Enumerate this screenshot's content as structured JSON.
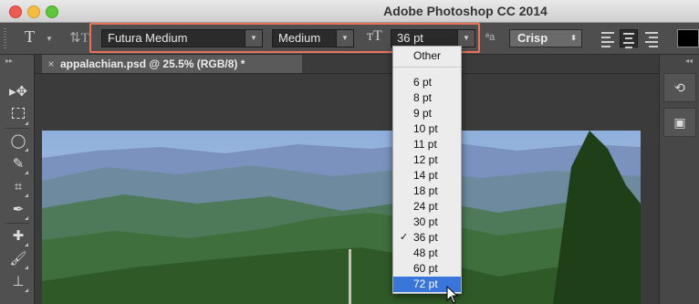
{
  "window": {
    "title": "Adobe Photoshop CC 2014"
  },
  "options_bar": {
    "tool_icon": "type-tool-icon",
    "font_family": "Futura Medium",
    "font_style": "Medium",
    "font_size": "36 pt",
    "antialias": "Crisp",
    "highlight_color": "#e8735a",
    "text_color": "#000000"
  },
  "document_tab": {
    "title": "appalachian.psd @ 25.5% (RGB/8) *"
  },
  "font_size_menu": {
    "header": "Other",
    "items": [
      {
        "label": "6 pt",
        "checked": false,
        "highlighted": false
      },
      {
        "label": "8 pt",
        "checked": false,
        "highlighted": false
      },
      {
        "label": "9 pt",
        "checked": false,
        "highlighted": false
      },
      {
        "label": "10 pt",
        "checked": false,
        "highlighted": false
      },
      {
        "label": "11 pt",
        "checked": false,
        "highlighted": false
      },
      {
        "label": "12 pt",
        "checked": false,
        "highlighted": false
      },
      {
        "label": "14 pt",
        "checked": false,
        "highlighted": false
      },
      {
        "label": "18 pt",
        "checked": false,
        "highlighted": false
      },
      {
        "label": "24 pt",
        "checked": false,
        "highlighted": false
      },
      {
        "label": "30 pt",
        "checked": false,
        "highlighted": false
      },
      {
        "label": "36 pt",
        "checked": true,
        "highlighted": false
      },
      {
        "label": "48 pt",
        "checked": false,
        "highlighted": false
      },
      {
        "label": "60 pt",
        "checked": false,
        "highlighted": false
      },
      {
        "label": "72 pt",
        "checked": false,
        "highlighted": true
      }
    ],
    "check_glyph": "✓",
    "selection_color": "#3876d9"
  }
}
